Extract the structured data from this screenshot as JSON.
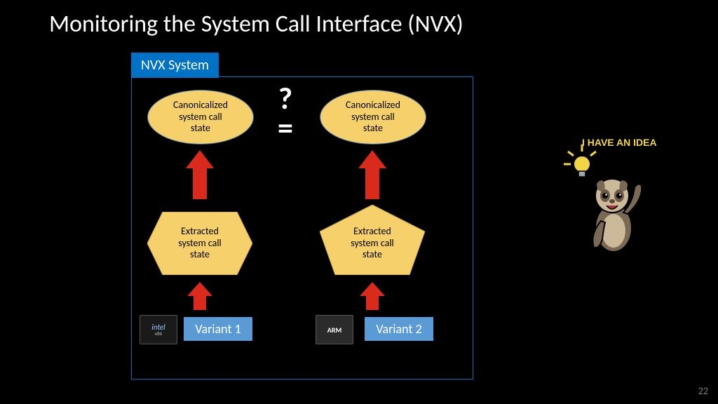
{
  "title": "Monitoring the System Call Interface (NVX)",
  "slide_number": "22",
  "nvx_label": "NVX System",
  "comparator": "?\n=",
  "left": {
    "canon": "Canonicalized\nsystem call\nstate",
    "extract": "Extracted\nsystem call\nstate",
    "variant": "Variant 1",
    "chip": "intel",
    "chip_sub": "x86"
  },
  "right": {
    "canon": "Canonicalized\nsystem call\nstate",
    "extract": "Extracted\nsystem call\nstate",
    "variant": "Variant 2",
    "chip": "ARM"
  },
  "cartoon": {
    "text": "I HAVE AN IDEA"
  }
}
